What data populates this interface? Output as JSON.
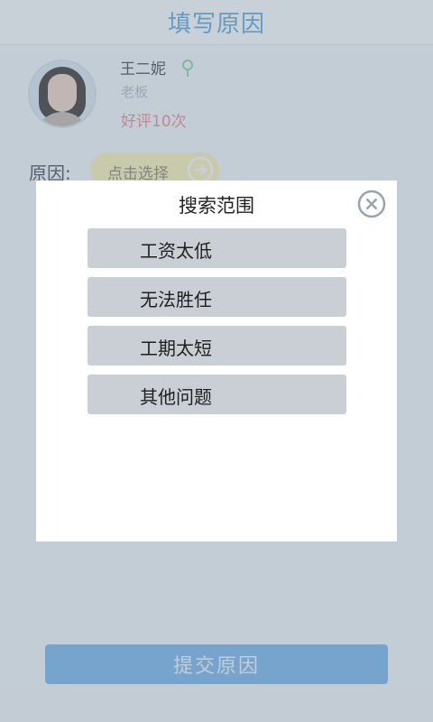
{
  "header": {
    "title": "填写原因"
  },
  "profile": {
    "name": "王二妮",
    "role": "老板",
    "rating": "好评10次"
  },
  "reason": {
    "label": "原因:",
    "select_text": "点击选择"
  },
  "submit": {
    "label": "提交原因"
  },
  "dialog": {
    "title": "搜索范围",
    "options": [
      {
        "label": "工资太低"
      },
      {
        "label": "无法胜任"
      },
      {
        "label": "工期太短"
      },
      {
        "label": "其他问题"
      }
    ]
  },
  "colors": {
    "header_title": "#5ba9df",
    "rating": "#f08a8a",
    "select_pill": "#fff3b8",
    "submit_button": "#7bb7ee",
    "option_bg": "#c9cfd4"
  }
}
